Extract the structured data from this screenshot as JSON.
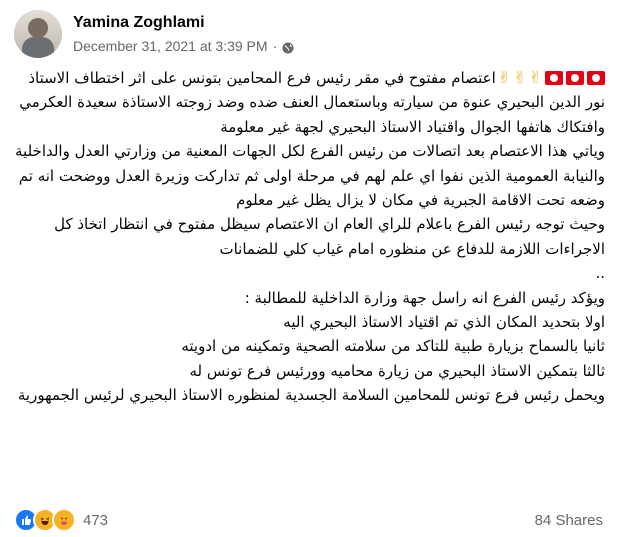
{
  "post": {
    "author": "Yamina Zoghlami",
    "date": "December 31, 2021 at 3:39 PM",
    "separator": "·",
    "audience_icon": "globe-icon",
    "lead_emojis": [
      "tunisia-flag",
      "tunisia-flag",
      "tunisia-flag",
      "victory-hand",
      "victory-hand",
      "victory-hand"
    ],
    "paragraphs": [
      "اعتصام مفتوح في مقر رئيس فرع المحامين بتونس على اثر اختطاف الاستاذ نور الدين البحيري عنوة من سيارته وباستعمال العنف ضده وضد زوجته الاستاذة سعيدة العكرمي وافتكاك هاتفها الجوال واقتياد الاستاذ البحيري لجهة غير معلومة",
      "وياتي هذا الاعتصام بعد اتصالات من رئيس الفرع لكل الجهات المعنية من وزارتي العدل والداخلية والنيابة العمومية الذين نفوا اي علم لهم في مرحلة اولى ثم تداركت وزيرة العدل ووضحت انه تم وضعه تحت الاقامة الجبرية في مكان لا يزال يظل غير معلوم",
      "وحيث توجه رئيس الفرع باعلام للراي العام ان الاعتصام سيظل مفتوح في انتظار اتخاذ كل الاجراءات اللازمة للدفاع عن منظوره امام  غياب كلي للضمانات",
      "..",
      "ويؤكد رئيس الفرع انه راسل جهة وزارة الداخلية للمطالبة :",
      "اولا بتحديد المكان  الذي تم اقتياد الاستاذ البحيري اليه",
      "ثانيا بالسماح بزيارة طبية للتاكد من سلامته الصحية وتمكينه من ادويته",
      "ثالثا بتمكين الاستاذ البحيري من زيارة محاميه وورئيس فرع تونس  له",
      "ويحمل رئيس فرع تونس للمحامين السلامة الجسدية لمنظوره الاستاذ البحيري لرئيس الجمهورية"
    ]
  },
  "footer": {
    "reaction_icons": [
      "like-icon",
      "haha-icon",
      "care-icon"
    ],
    "reaction_count": "473",
    "shares": "84 Shares"
  },
  "colors": {
    "text": "#050505",
    "meta": "#65676b",
    "like": "#1877f2",
    "flag_red": "#e70013"
  }
}
